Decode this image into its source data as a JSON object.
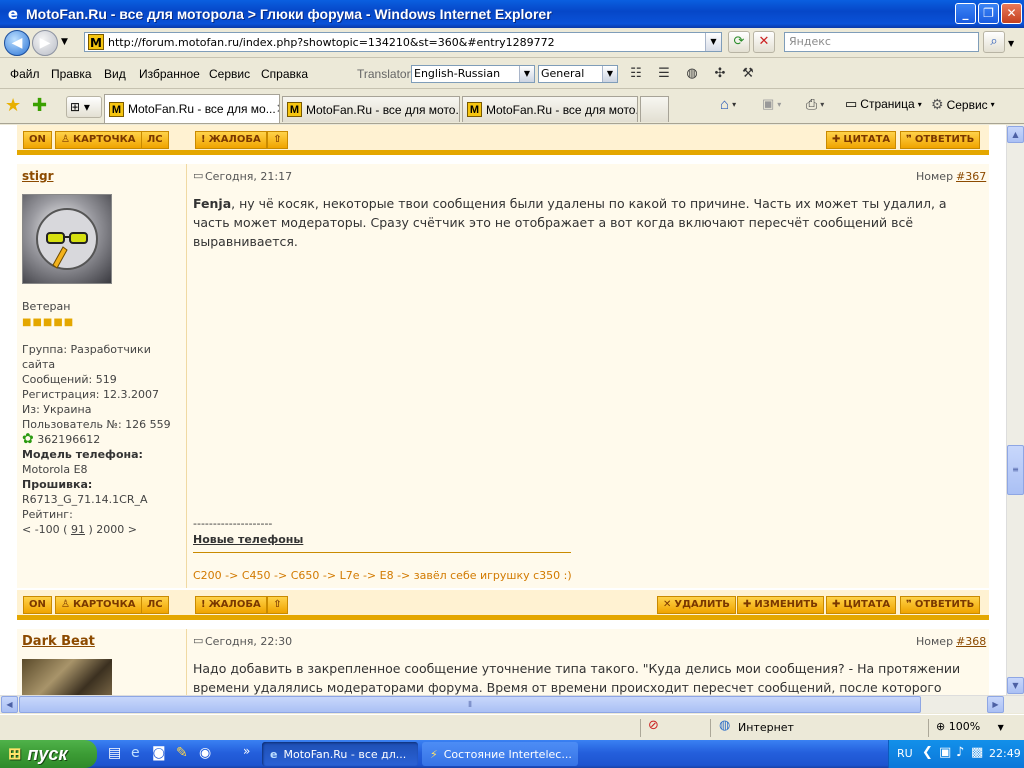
{
  "window": {
    "title": "MotoFan.Ru - все для моторола > Глюки форума - Windows Internet Explorer"
  },
  "address": {
    "url": "http://forum.motofan.ru/index.php?showtopic=134210&st=360&#entry1289772",
    "search_placeholder": "Яндекс"
  },
  "menu": {
    "items": [
      "Файл",
      "Правка",
      "Вид",
      "Избранное",
      "Сервис",
      "Справка"
    ],
    "translator_label": "Translator",
    "translator_lang": "English-Russian",
    "translator_mode": "General"
  },
  "tabs": [
    {
      "label": "MotoFan.Ru - все для мо...",
      "active": true
    },
    {
      "label": "MotoFan.Ru - все для мото...",
      "active": false
    },
    {
      "label": "MotoFan.Ru - все для мото...",
      "active": false
    }
  ],
  "commandbar": {
    "page_label": "Страница",
    "service_label": "Сервис"
  },
  "forum": {
    "buttons": {
      "on": "ON",
      "card": "КАРТОЧКА",
      "pm": "ЛС",
      "report": "ЖАЛОБА",
      "quote": "ЦИТАТА",
      "reply": "ОТВЕТИТЬ",
      "delete": "УДАЛИТЬ",
      "edit": "ИЗМЕНИТЬ"
    },
    "post1": {
      "author": "stigr",
      "date": "Сегодня, 21:17",
      "number_label": "Номер",
      "number": "#367",
      "rank": "Ветеран",
      "group_label": "Группа:",
      "group": "Разработчики сайта",
      "messages_label": "Сообщений:",
      "messages": "519",
      "registered_label": "Регистрация:",
      "registered": "12.3.2007",
      "from_label": "Из:",
      "from": "Украина",
      "user_no_label": "Пользователь №:",
      "user_no": "126 559",
      "icq": "362196612",
      "phone_label": "Модель телефона:",
      "phone": "Motorola E8",
      "firmware_label": "Прошивка:",
      "firmware": "R6713_G_71.14.1CR_A",
      "rating_label": "Рейтинг:",
      "rating_left": "< -100 (",
      "rating_value": "91",
      "rating_right": ") 2000 >",
      "addressee": "Fenja",
      "text": ", ну чё косяк, некоторые твои сообщения были удалены по какой то причине. Часть их может ты удалил, а часть может модераторы. Сразу счётчик это не отображает а вот когда включают пересчёт сообщений всё выравнивается.",
      "sig_dashes": "--------------------",
      "sig_link": "Новые телефоны",
      "sig_phones": "C200 -> C450 -> C650 -> L7e -> E8 -> завёл себе игрушку с350 :)"
    },
    "post2": {
      "author": "Dark Beat",
      "date": "Сегодня, 22:30",
      "number_label": "Номер",
      "number": "#368",
      "text": "Надо добавить в закрепленное сообщение уточнение типа такого. \"Куда делись мои сообщения? - На протяжении времени удалялись модераторами форума. Время от времени происходит пересчет сообщений, после которого"
    }
  },
  "status": {
    "zone": "Интернет",
    "zoom": "100%"
  },
  "taskbar": {
    "start": "пуск",
    "tasks": [
      "MotoFan.Ru - все дл...",
      "Состояние Intertelec..."
    ],
    "lang": "RU",
    "clock": "22:49"
  }
}
